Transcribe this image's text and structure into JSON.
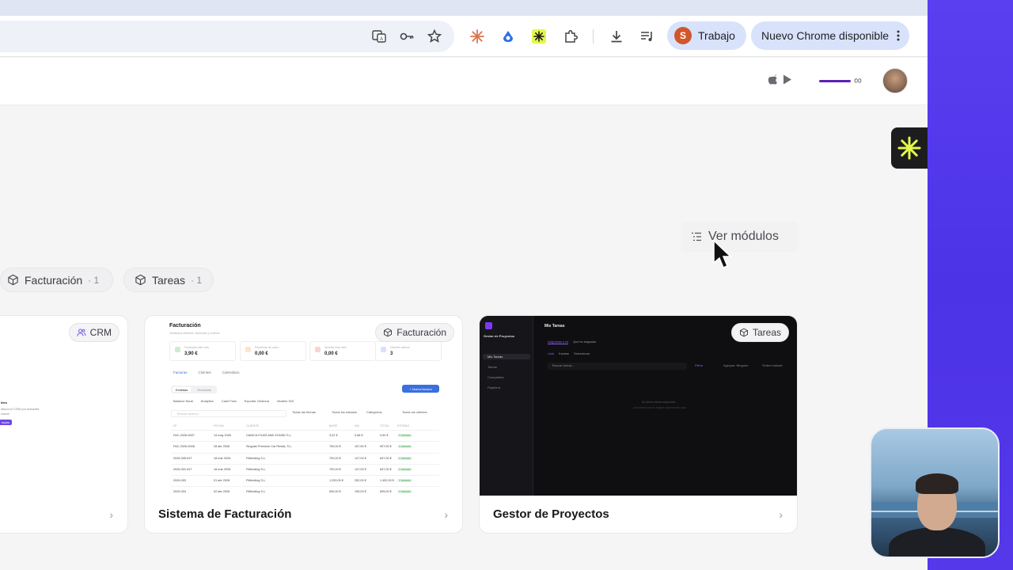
{
  "browser": {
    "profile_label": "Trabajo",
    "profile_initial": "S",
    "update_label": "Nuevo Chrome disponible",
    "colors": {
      "accent": "#d8e2fb",
      "profile": "#d0572a"
    }
  },
  "header": {
    "infinity": "∞"
  },
  "actions": {
    "ver_modulos": "Ver módulos"
  },
  "filters": [
    {
      "label": "Facturación",
      "count": "· 1"
    },
    {
      "label": "Tareas",
      "count": "· 1"
    }
  ],
  "cards": [
    {
      "title": "",
      "badge": "CRM"
    },
    {
      "title": "Sistema de Facturación",
      "badge": "Facturación"
    },
    {
      "title": "Gestor de Proyectos",
      "badge": "Tareas"
    }
  ],
  "crm_thumb": {
    "line1": "ities",
    "line2": "stiona el CRM por industria",
    "line3": "cional",
    "button": "mpiar"
  },
  "invoice_thumb": {
    "title": "Facturación",
    "subtitle": "Gestiona clientes, facturas y cobros",
    "stats": [
      {
        "label": "Facturado este mes",
        "value": "3,90 €",
        "color": "#cdeccf"
      },
      {
        "label": "Pendiente de cobro",
        "value": "0,00 €",
        "color": "#fde4cc"
      },
      {
        "label": "Vencido este mes",
        "value": "0,00 €",
        "color": "#fbd3d3"
      },
      {
        "label": "Clientes activos",
        "value": "3",
        "color": "#d6e2fb"
      }
    ],
    "tabs": [
      "Facturas",
      "Clientes",
      "Calendario"
    ],
    "segments": [
      "Emitidas",
      "Recibidas"
    ],
    "new_button": "+ Nueva factura",
    "actions": [
      "Balance fiscal",
      "Analytics",
      "Cash Flow",
      "Exportar Gestoría",
      "Modelo 303"
    ],
    "search_placeholder": "Buscar factura...",
    "filters": [
      "Todas las fechas",
      "Todos los estados",
      "Categorías",
      "Todos los clientes"
    ],
    "columns": [
      "Nº",
      "FECHA",
      "CLIENTE",
      "BASE",
      "IVA",
      "TOTAL",
      "ESTADO"
    ],
    "rows": [
      [
        "FAC-2026-0007",
        "14 may 2026",
        "CANICA FILMS AND SOUND S.L.",
        "3,22 €",
        "0,68 €",
        "3,90 €",
        "Cobrada"
      ],
      [
        "FAC-2026-0008",
        "28 abr 2026",
        "Singular Premium Car Rental, S.L.",
        "750,00 €",
        "157,50 €",
        "907,50 €",
        "Cobrada"
      ],
      [
        "2026-005-INT",
        "18 mar 2026",
        "Flitlending S.L.",
        "700,00 €",
        "147,00 €",
        "847,00 €",
        "Cobrada"
      ],
      [
        "2026-001-INT",
        "18 mar 2026",
        "Flitlending S.L.",
        "700,00 €",
        "147,00 €",
        "847,00 €",
        "Cobrada"
      ],
      [
        "2026-003",
        "01 abr 2026",
        "Flitlending S.L.",
        "1.200,00 €",
        "252,00 €",
        "1.452,00 €",
        "Cobrada"
      ],
      [
        "2026-004",
        "02 abr 2026",
        "Flitlending S.L.",
        "500,00 €",
        "105,00 €",
        "605,00 €",
        "Cobrada"
      ]
    ]
  },
  "project_thumb": {
    "sidebar_title": "Gestor de Proyectos",
    "nav": [
      "Mis Tareas",
      "Tareas",
      "Compartido",
      "Papelera"
    ],
    "title": "Mis Tareas",
    "tabs": [
      "Asignadas a mí",
      "Que he asignado"
    ],
    "subtabs": [
      "Lista",
      "Kanban",
      "Seleccionar"
    ],
    "search_placeholder": "Buscar tareas...",
    "controls": [
      "Filtrar",
      "Agrupar: Ninguno",
      "Orden manual"
    ],
    "empty_title": "No tienes tareas asignadas",
    "empty_text": "Las tareas que te asignen aparecerán aquí"
  }
}
